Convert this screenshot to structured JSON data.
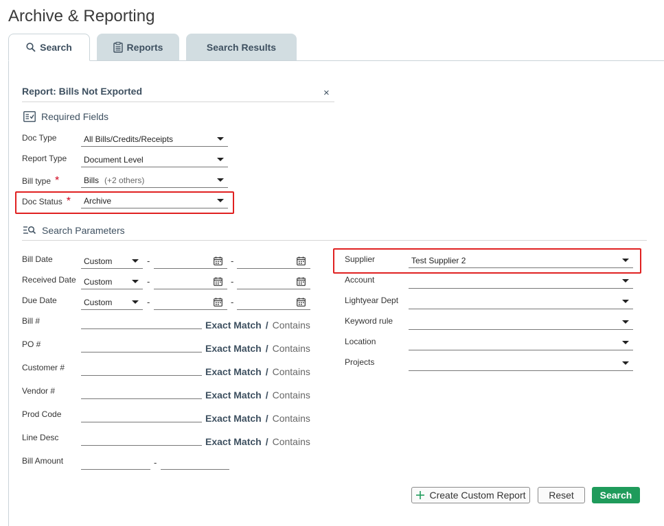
{
  "page": {
    "title": "Archive & Reporting"
  },
  "tabs": [
    {
      "label": "Search",
      "icon": "search-icon",
      "active": true
    },
    {
      "label": "Reports",
      "icon": "clipboard-icon",
      "active": false
    },
    {
      "label": "Search Results",
      "active": false
    }
  ],
  "report": {
    "title": "Report: Bills Not Exported",
    "close": "×"
  },
  "required": {
    "title": "Required Fields",
    "doc_type": {
      "label": "Doc Type",
      "value": "All Bills/Credits/Receipts"
    },
    "report_type": {
      "label": "Report Type",
      "value": "Document Level"
    },
    "bill_type": {
      "label": "Bill type",
      "value": "Bills",
      "extra": "(+2 others)",
      "required_mark": "*"
    },
    "doc_status": {
      "label": "Doc Status",
      "value": "Archive",
      "required_mark": "*"
    }
  },
  "search_params": {
    "title": "Search Parameters",
    "dates": [
      {
        "label": "Bill Date",
        "range": "Custom",
        "dash": "-",
        "dash2": "-"
      },
      {
        "label": "Received Date",
        "range": "Custom",
        "dash": "-",
        "dash2": "-"
      },
      {
        "label": "Due Date",
        "range": "Custom",
        "dash": "-",
        "dash2": "-"
      }
    ],
    "text_fields": [
      {
        "label": "Bill #"
      },
      {
        "label": "PO #"
      },
      {
        "label": "Customer #"
      },
      {
        "label": "Vendor #"
      },
      {
        "label": "Prod Code"
      },
      {
        "label": "Line Desc"
      }
    ],
    "match": {
      "exact": "Exact Match",
      "sep": "/",
      "contains": "Contains"
    },
    "bill_amount": {
      "label": "Bill Amount",
      "dash": "-"
    },
    "right_fields": [
      {
        "label": "Supplier",
        "value": "Test Supplier 2"
      },
      {
        "label": "Account",
        "value": ""
      },
      {
        "label": "Lightyear Dept",
        "value": ""
      },
      {
        "label": "Keyword rule",
        "value": ""
      },
      {
        "label": "Location",
        "value": ""
      },
      {
        "label": "Projects",
        "value": ""
      }
    ]
  },
  "actions": {
    "create": "Create Custom Report",
    "reset": "Reset",
    "search": "Search"
  },
  "colors": {
    "primary_button": "#1f9b5b",
    "highlight_border": "#e02020",
    "label_text": "#3e5060",
    "required_asterisk": "#d0021b"
  }
}
